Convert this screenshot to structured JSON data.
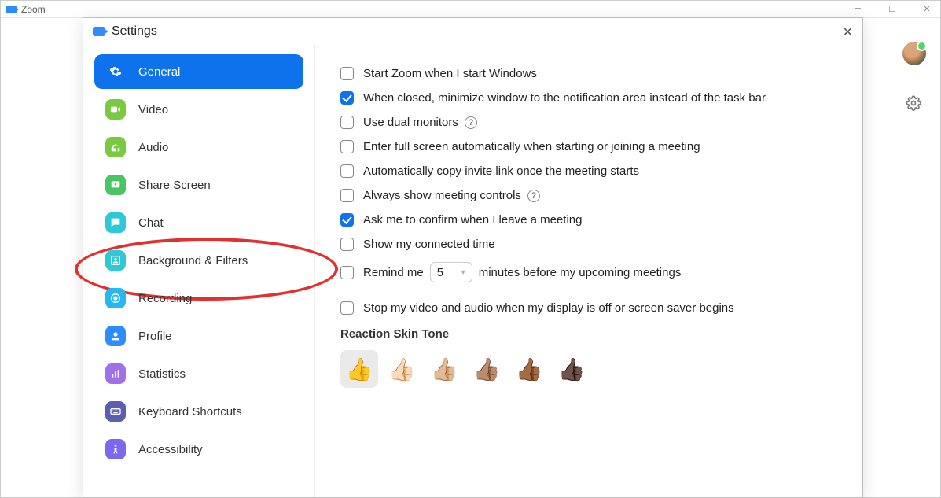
{
  "mainWindow": {
    "title": "Zoom"
  },
  "settings": {
    "title": "Settings",
    "sidebar": {
      "items": [
        {
          "label": "General",
          "iconColor": "#ffffff",
          "iconBg": "#0e72ed",
          "active": true,
          "icon": "gear"
        },
        {
          "label": "Video",
          "iconColor": "#ffffff",
          "iconBg": "#7ac943",
          "icon": "video"
        },
        {
          "label": "Audio",
          "iconColor": "#ffffff",
          "iconBg": "#7ac943",
          "icon": "audio"
        },
        {
          "label": "Share Screen",
          "iconColor": "#ffffff",
          "iconBg": "#47c764",
          "icon": "share"
        },
        {
          "label": "Chat",
          "iconColor": "#ffffff",
          "iconBg": "#2dc9d6",
          "icon": "chat"
        },
        {
          "label": "Background & Filters",
          "iconColor": "#ffffff",
          "iconBg": "#2dc9d6",
          "icon": "person"
        },
        {
          "label": "Recording",
          "iconColor": "#ffffff",
          "iconBg": "#26b8f0",
          "icon": "record"
        },
        {
          "label": "Profile",
          "iconColor": "#ffffff",
          "iconBg": "#2d8cff",
          "icon": "profile"
        },
        {
          "label": "Statistics",
          "iconColor": "#ffffff",
          "iconBg": "#a070e8",
          "icon": "stats"
        },
        {
          "label": "Keyboard Shortcuts",
          "iconColor": "#ffffff",
          "iconBg": "#5c5faf",
          "icon": "keyboard"
        },
        {
          "label": "Accessibility",
          "iconColor": "#ffffff",
          "iconBg": "#7b68ee",
          "icon": "access"
        }
      ]
    },
    "options": [
      {
        "label": "Start Zoom when I start Windows",
        "checked": false
      },
      {
        "label": "When closed, minimize window to the notification area instead of the task bar",
        "checked": true
      },
      {
        "label": "Use dual monitors",
        "checked": false,
        "help": true
      },
      {
        "label": "Enter full screen automatically when starting or joining a meeting",
        "checked": false
      },
      {
        "label": "Automatically copy invite link once the meeting starts",
        "checked": false
      },
      {
        "label": "Always show meeting controls",
        "checked": false,
        "help": true
      },
      {
        "label": "Ask me to confirm when I leave a meeting",
        "checked": true
      },
      {
        "label": "Show my connected time",
        "checked": false
      }
    ],
    "remind": {
      "prefix": "Remind me",
      "value": "5",
      "suffix": "minutes before my upcoming meetings",
      "checked": false
    },
    "stopVideo": {
      "label": "Stop my video and audio when my display is off or screen saver begins",
      "checked": false
    },
    "skinTone": {
      "heading": "Reaction Skin Tone",
      "tones": [
        "👍",
        "👍🏻",
        "👍🏼",
        "👍🏽",
        "👍🏾",
        "👍🏿"
      ],
      "selected": 0
    }
  }
}
